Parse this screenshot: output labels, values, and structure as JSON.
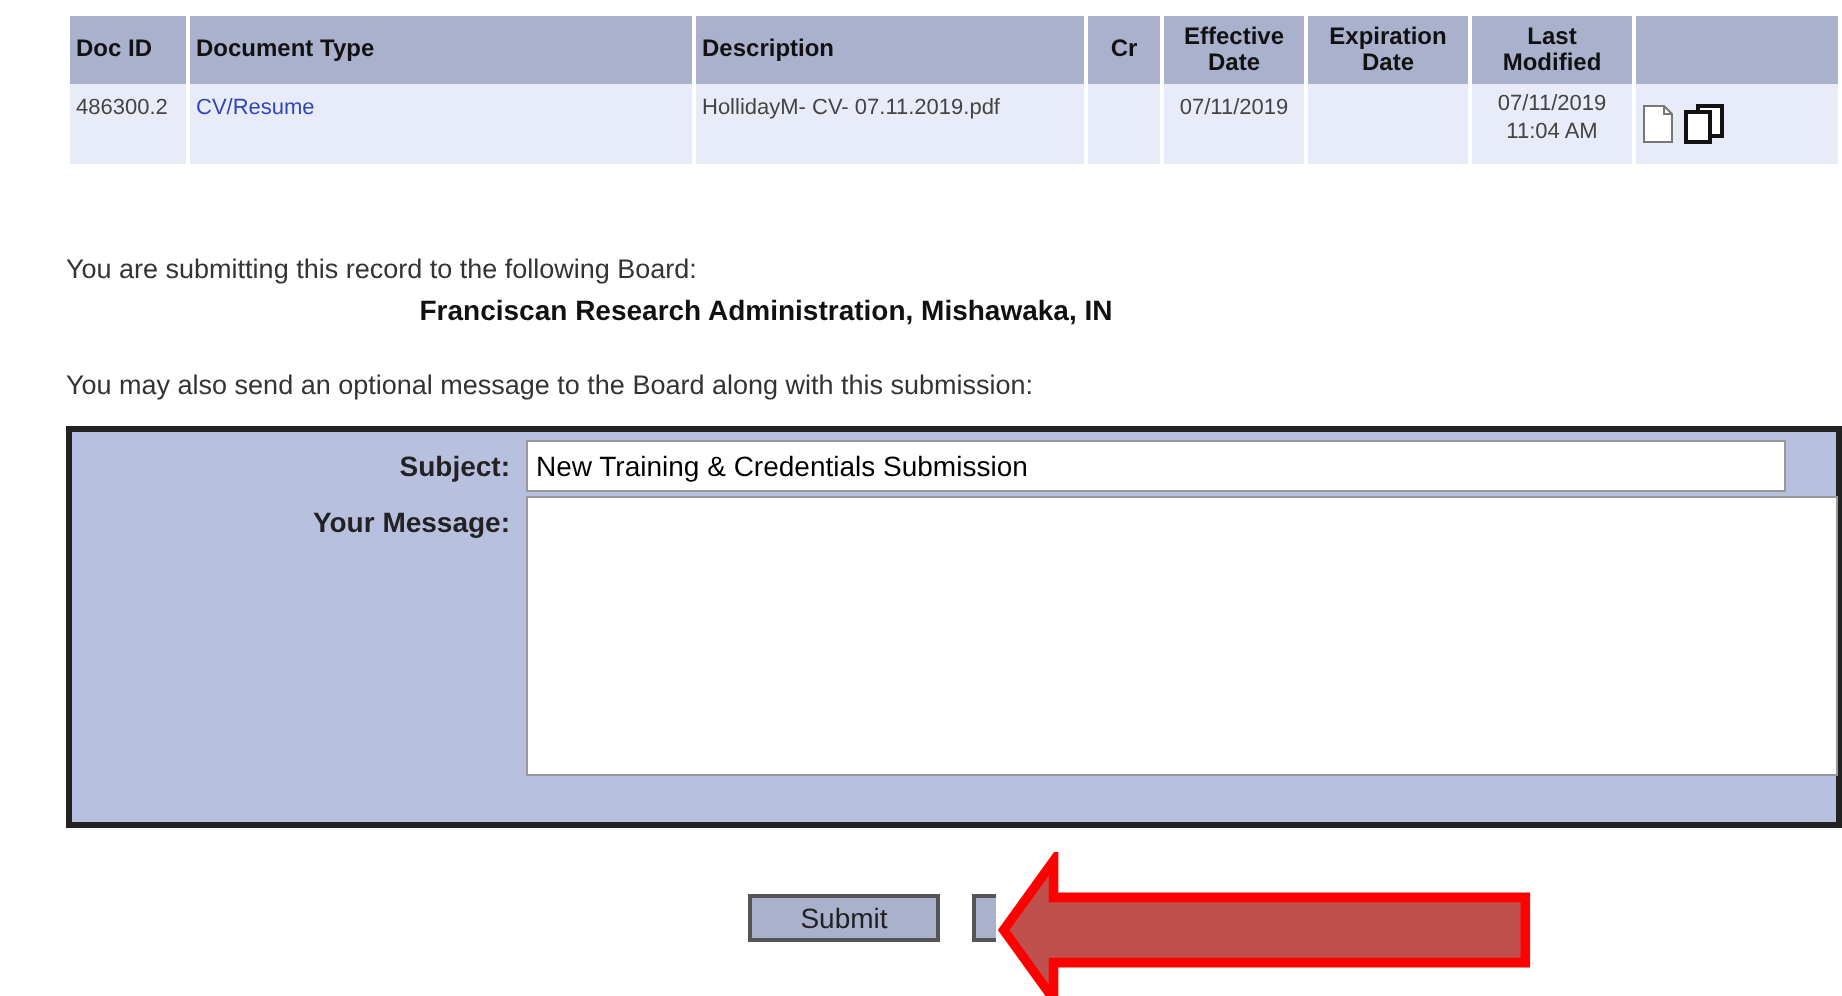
{
  "table": {
    "columns": [
      "Doc ID",
      "Document Type",
      "Description",
      "Cr",
      "Effective Date",
      "Expiration Date",
      "Last Modified"
    ],
    "rows": [
      {
        "doc_id": "486300.2",
        "document_type": "CV/Resume",
        "description": "HollidayM- CV- 07.11.2019.pdf",
        "effective_date": "07/11/2019",
        "last_modified": [
          "07/11/2019",
          "11:04 AM"
        ]
      }
    ]
  },
  "board": {
    "intro": "You are submitting this record to the following Board:",
    "name": "Franciscan Research Administration, Mishawaka, IN"
  },
  "message_intro": "You may also send an optional message to the Board along with this submission:",
  "form": {
    "subject_label": "Subject:",
    "subject_value": "New Training & Credentials Submission",
    "message_label": "Your Message:"
  },
  "buttons": [
    {
      "kind": "labeled",
      "label": "Submit"
    },
    {
      "kind": "covered"
    }
  ]
}
